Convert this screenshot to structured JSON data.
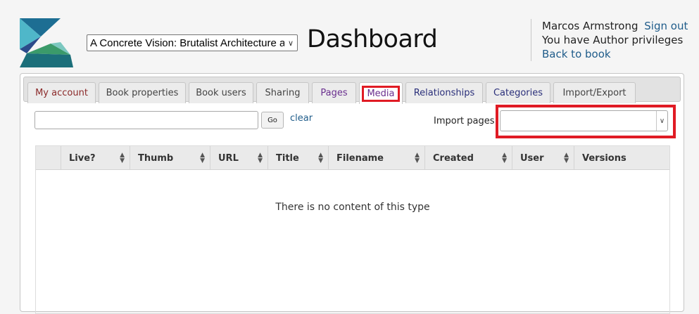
{
  "header": {
    "book_select_value": "A Concrete Vision: Brutalist Architecture at",
    "page_title": "Dashboard",
    "user_name": "Marcos Armstrong",
    "sign_out": "Sign out",
    "privileges": "You have Author privileges",
    "back_to_book": "Back to book"
  },
  "tabs": [
    {
      "label": "My account",
      "color": "#8b2a2a"
    },
    {
      "label": "Book properties",
      "color": "#444444"
    },
    {
      "label": "Book users",
      "color": "#444444"
    },
    {
      "label": "Sharing",
      "color": "#444444"
    },
    {
      "label": "Pages",
      "color": "#6a2f8f"
    },
    {
      "label": "Media",
      "color": "#6a2f8f"
    },
    {
      "label": "Relationships",
      "color": "#2a2f7a"
    },
    {
      "label": "Categories",
      "color": "#2a2f7a"
    },
    {
      "label": "Import/Export",
      "color": "#444444"
    }
  ],
  "toolbar": {
    "search_value": "",
    "go_label": "Go",
    "clear_label": "clear",
    "import_label": "Import pages:",
    "import_value": ""
  },
  "table": {
    "columns": [
      "",
      "Live?",
      "Thumb",
      "URL",
      "Title",
      "Filename",
      "Created",
      "User",
      "Versions"
    ],
    "empty_message": "There is no content of this type"
  },
  "colors": {
    "highlight": "#e01b24",
    "link": "#1f5c8a"
  },
  "icons": [
    "logo",
    "chevron-down-icon",
    "sort-icon"
  ]
}
